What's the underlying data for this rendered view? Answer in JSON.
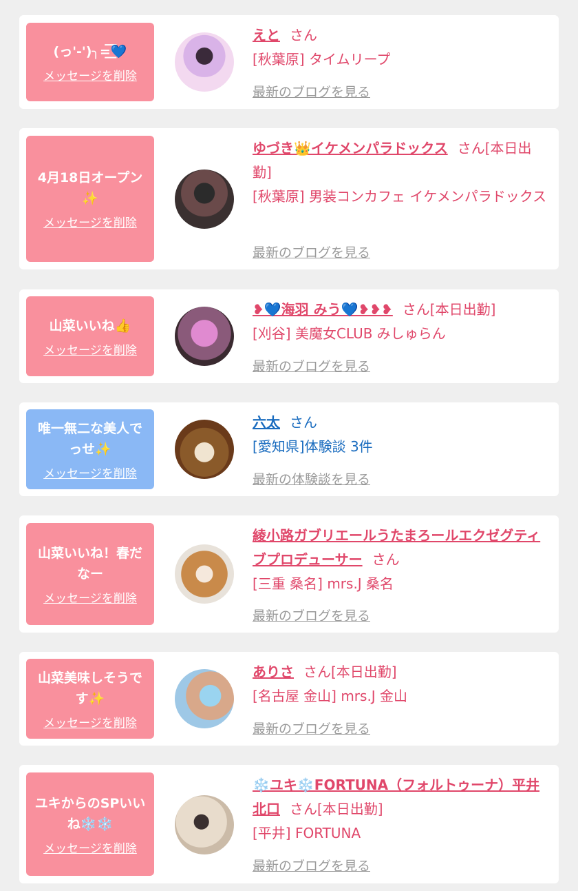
{
  "colors": {
    "pink_bubble": "#f9909d",
    "blue_bubble": "#8ab8f5",
    "pink_text": "#e0476a",
    "blue_text": "#1a6cbf",
    "link_gray": "#9a9a9a"
  },
  "delete_label": "メッセージを削除",
  "entries": [
    {
      "message_line1": "(っ'-')╮=͟͟͞͞💙",
      "message_line2": "",
      "name": "えと",
      "suffix": "さん",
      "shop": "[秋葉原] タイムリープ",
      "link": "最新のブログを見る"
    },
    {
      "message_line1": "4月18日オープン",
      "message_line2": "✨",
      "name": "ゆづき👑イケメンパラドックス",
      "suffix": "さん[本日出勤]",
      "shop": "[秋葉原] 男装コンカフェ イケメンパラドックス",
      "link": "最新のブログを見る"
    },
    {
      "message_line1": "山菜いいね👍",
      "message_line2": "",
      "name": "❥💙海羽 みう💙❥❥❥",
      "suffix": "さん[本日出勤]",
      "shop": "[刈谷] 美魔女CLUB みしゅらん",
      "link": "最新のブログを見る"
    },
    {
      "message_line1": "唯一無二な美人で",
      "message_line2": "っせ✨",
      "name": "六太",
      "suffix": "さん",
      "shop": "[愛知県]体験談 3件",
      "link": "最新の体験談を見る"
    },
    {
      "message_line1": "山菜いいね！春だ",
      "message_line2": "なー",
      "name": "綾小路ガブリエールうたまろールエクゼグティブプロデューサー",
      "suffix": "さん",
      "shop": "[三重 桑名] mrs.J 桑名",
      "link": "最新のブログを見る"
    },
    {
      "message_line1": "山菜美味しそうで",
      "message_line2": "す✨",
      "name": "ありさ",
      "suffix": "さん[本日出勤]",
      "shop": "[名古屋 金山] mrs.J 金山",
      "link": "最新のブログを見る"
    },
    {
      "message_line1": "ユキからのSPいい",
      "message_line2": "ね❄️❄️",
      "name": "❄️ユキ❄️FORTUNA（フォルトゥーナ）平井北口",
      "suffix": "さん[本日出勤]",
      "shop": "[平井] FORTUNA",
      "link": "最新のブログを見る"
    }
  ]
}
